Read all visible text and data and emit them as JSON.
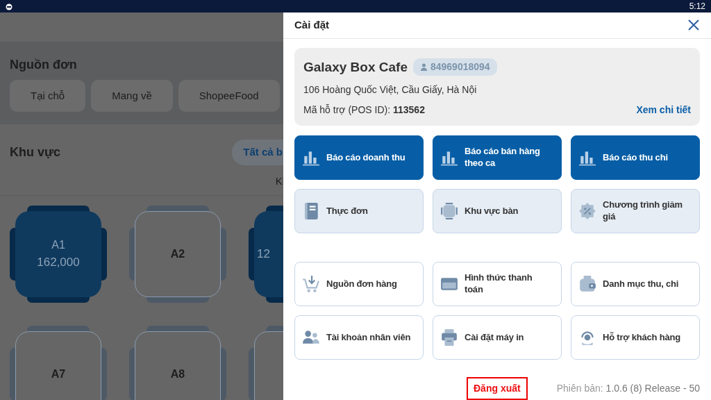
{
  "status_bar": {
    "time": "5:12"
  },
  "background": {
    "order_source": {
      "title": "Nguồn đơn",
      "options": [
        "Tại chỗ",
        "Mang về",
        "ShopeeFood"
      ]
    },
    "area": {
      "title": "Khu vực",
      "filter": "Tất cả b",
      "column_3": "Kl"
    },
    "tables": [
      {
        "name": "A1",
        "amount": "162,000",
        "occupied": true
      },
      {
        "name": "A2",
        "occupied": false
      },
      {
        "amount": "12",
        "occupied": true
      },
      {
        "name": "A7",
        "occupied": false
      },
      {
        "name": "A8",
        "occupied": false
      },
      {
        "occupied": false
      }
    ]
  },
  "settings_panel": {
    "title": "Cài đặt",
    "store": {
      "name": "Galaxy Box Cafe",
      "phone": "84969018094",
      "address": "106 Hoàng Quốc Việt, Cầu Giấy, Hà Nội",
      "support_label": "Mã hỗ trợ (POS ID):",
      "support_id": "113562",
      "details_link": "Xem chi tiết"
    },
    "tile_rows": [
      {
        "kind": "report",
        "items": [
          "Báo cáo doanh thu",
          "Báo cáo bán hàng theo ca",
          "Báo cáo thu chi"
        ]
      },
      {
        "kind": "feature",
        "items": [
          "Thực đơn",
          "Khu vực bàn",
          "Chương trình giảm giá"
        ]
      },
      {
        "kind": "setting",
        "items": [
          "Nguồn đơn hàng",
          "Hình thức thanh toán",
          "Danh mục thu, chi"
        ]
      },
      {
        "kind": "setting",
        "items": [
          "Tài khoản nhân viên",
          "Cài đặt máy in",
          "Hỗ trợ khách hàng"
        ]
      }
    ],
    "logout": "Đăng xuất",
    "version_label": "Phiên bản:",
    "version": "1.0.6 (8) Release - 50"
  }
}
